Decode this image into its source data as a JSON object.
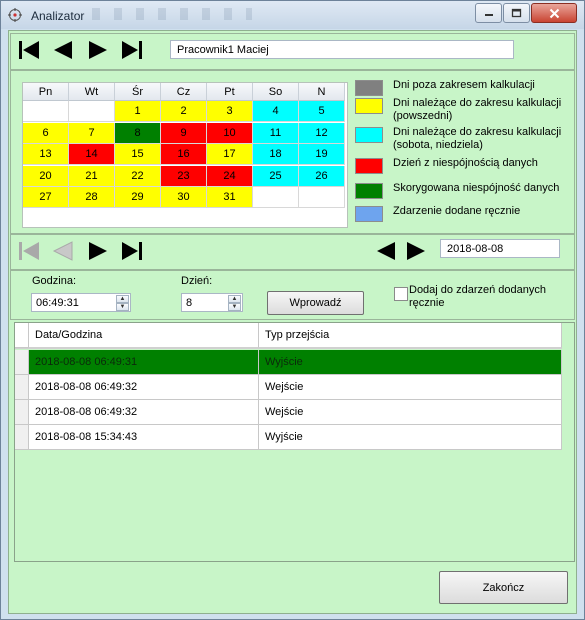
{
  "window": {
    "title": "Analizator",
    "controls": [
      "minimize-icon",
      "maximize-icon",
      "close-icon"
    ]
  },
  "employee": {
    "name": "Pracownik1  Maciej"
  },
  "calendar": {
    "weekdays": [
      "Pn",
      "Wt",
      "Śr",
      "Cz",
      "Pt",
      "So",
      "N"
    ],
    "weeks": [
      [
        {
          "d": "",
          "c": "white"
        },
        {
          "d": "",
          "c": "white"
        },
        {
          "d": "1",
          "c": "yellow"
        },
        {
          "d": "2",
          "c": "yellow"
        },
        {
          "d": "3",
          "c": "yellow"
        },
        {
          "d": "4",
          "c": "cyan"
        },
        {
          "d": "5",
          "c": "cyan"
        }
      ],
      [
        {
          "d": "6",
          "c": "yellow"
        },
        {
          "d": "7",
          "c": "yellow"
        },
        {
          "d": "8",
          "c": "green"
        },
        {
          "d": "9",
          "c": "red"
        },
        {
          "d": "10",
          "c": "red"
        },
        {
          "d": "11",
          "c": "cyan"
        },
        {
          "d": "12",
          "c": "cyan"
        }
      ],
      [
        {
          "d": "13",
          "c": "yellow"
        },
        {
          "d": "14",
          "c": "red"
        },
        {
          "d": "15",
          "c": "yellow"
        },
        {
          "d": "16",
          "c": "red"
        },
        {
          "d": "17",
          "c": "yellow"
        },
        {
          "d": "18",
          "c": "cyan"
        },
        {
          "d": "19",
          "c": "cyan"
        }
      ],
      [
        {
          "d": "20",
          "c": "yellow"
        },
        {
          "d": "21",
          "c": "yellow"
        },
        {
          "d": "22",
          "c": "yellow"
        },
        {
          "d": "23",
          "c": "red"
        },
        {
          "d": "24",
          "c": "red"
        },
        {
          "d": "25",
          "c": "cyan"
        },
        {
          "d": "26",
          "c": "cyan"
        }
      ],
      [
        {
          "d": "27",
          "c": "yellow"
        },
        {
          "d": "28",
          "c": "yellow"
        },
        {
          "d": "29",
          "c": "yellow"
        },
        {
          "d": "30",
          "c": "yellow"
        },
        {
          "d": "31",
          "c": "yellow"
        },
        {
          "d": "",
          "c": "white"
        },
        {
          "d": "",
          "c": "white"
        }
      ]
    ]
  },
  "legend": [
    {
      "color": "#808080",
      "text": "Dni poza zakresem kalkulacji"
    },
    {
      "color": "#ffff00",
      "text": "Dni należące do zakresu kalkulacji (powszedni)"
    },
    {
      "color": "#00ffff",
      "text": "Dni należące do zakresu kalkulacji (sobota, niedziela)"
    },
    {
      "color": "#ff0000",
      "text": "Dzień z niespójnością danych"
    },
    {
      "color": "#008000",
      "text": "Skorygowana niespójność danych"
    },
    {
      "color": "#6ea4ee",
      "text": "Zdarzenie dodane ręcznie"
    }
  ],
  "date_nav": {
    "date": "2018-08-08"
  },
  "entry": {
    "time_label": "Godzina:",
    "time_value": "06:49:31",
    "day_label": "Dzień:",
    "day_value": "8",
    "submit_label": "Wprowadź",
    "checkbox_label": "Dodaj do zdarzeń dodanych ręcznie",
    "checkbox_checked": false
  },
  "events": {
    "columns": [
      "Data/Godzina",
      "Typ przejścia"
    ],
    "rows": [
      {
        "datetime": "2018-08-08 06:49:31",
        "type": "Wyjście",
        "selected": true
      },
      {
        "datetime": "2018-08-08 06:49:32",
        "type": "Wejście",
        "selected": false
      },
      {
        "datetime": "2018-08-08 06:49:32",
        "type": "Wejście",
        "selected": false
      },
      {
        "datetime": "2018-08-08 15:34:43",
        "type": "Wyjście",
        "selected": false
      }
    ]
  },
  "footer": {
    "close_label": "Zakończ"
  },
  "colors": {
    "client_bg": "#c8f5c8",
    "yellow": "#ffff00",
    "cyan": "#00ffff",
    "red": "#ff0000",
    "green": "#008000"
  }
}
